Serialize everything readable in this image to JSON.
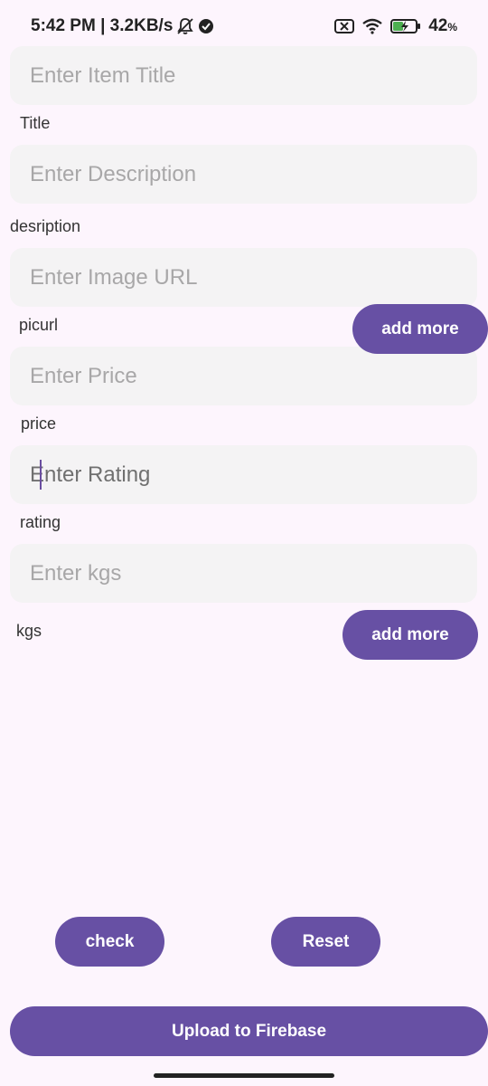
{
  "status_bar": {
    "time_speed": "5:42 PM | 3.2KB/s",
    "battery_percent": "42",
    "battery_unit": "%",
    "icons": [
      "bell-off-icon",
      "check-circle-icon",
      "sim-off-icon",
      "wifi-icon",
      "battery-charging-icon"
    ]
  },
  "form": {
    "title": {
      "placeholder": "Enter Item Title",
      "label": "Title"
    },
    "description": {
      "placeholder": "Enter Description",
      "label": "desription"
    },
    "image_url": {
      "placeholder": "Enter Image URL",
      "label": "picurl"
    },
    "price": {
      "placeholder": "Enter Price",
      "label": "price"
    },
    "rating": {
      "placeholder": "Enter Rating",
      "label": "rating"
    },
    "kgs": {
      "placeholder": "Enter kgs",
      "label": "kgs"
    }
  },
  "buttons": {
    "add_more_pics": "add more",
    "add_more_kgs": "add more",
    "check": "check",
    "reset": "Reset",
    "upload": "Upload to Firebase"
  },
  "colors": {
    "background": "#fdf5fd",
    "field_bg": "#f4f3f4",
    "accent": "#6750a4"
  }
}
